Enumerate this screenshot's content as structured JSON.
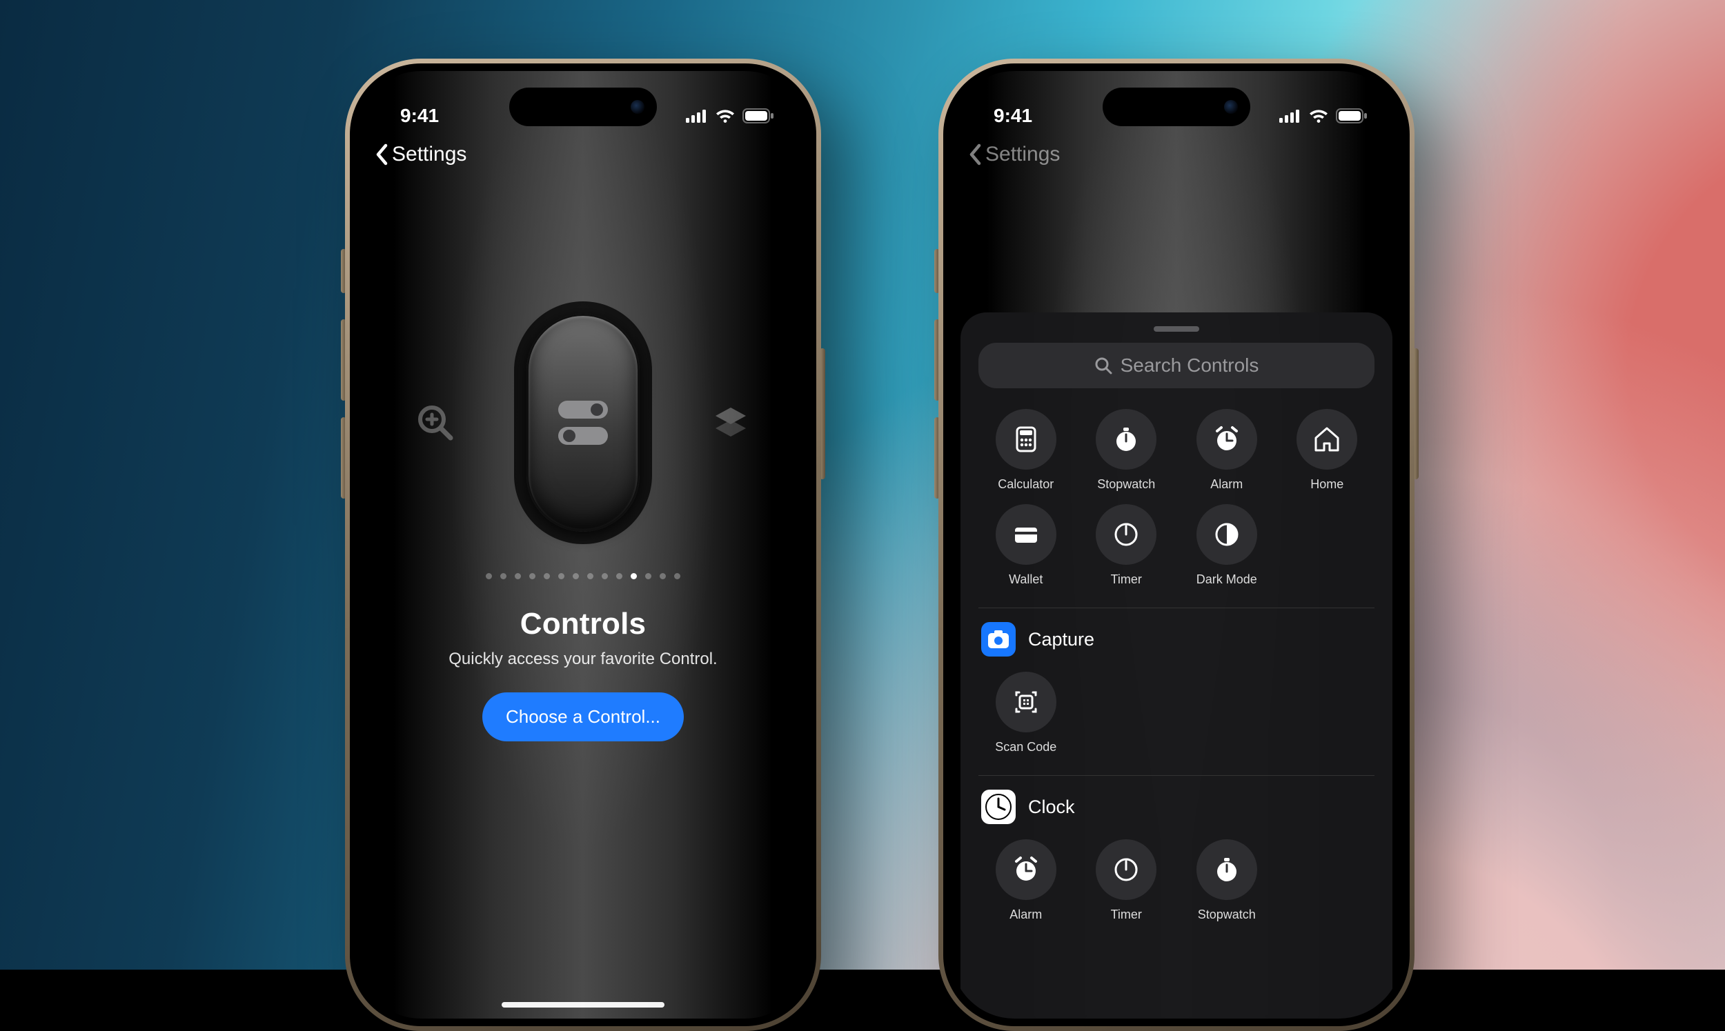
{
  "status": {
    "time": "9:41"
  },
  "nav": {
    "back": "Settings"
  },
  "left": {
    "title": "Controls",
    "subtitle": "Quickly access your favorite Control.",
    "button": "Choose a Control...",
    "page_dots": 14,
    "active_dot_index": 10
  },
  "right": {
    "search_placeholder": "Search Controls",
    "featured": [
      {
        "name": "Calculator",
        "icon": "calculator"
      },
      {
        "name": "Stopwatch",
        "icon": "stopwatch"
      },
      {
        "name": "Alarm",
        "icon": "alarm"
      },
      {
        "name": "Home",
        "icon": "home"
      },
      {
        "name": "Wallet",
        "icon": "wallet"
      },
      {
        "name": "Timer",
        "icon": "timer"
      },
      {
        "name": "Dark Mode",
        "icon": "darkmode"
      }
    ],
    "sections": [
      {
        "title": "Capture",
        "badge": "camera",
        "items": [
          {
            "name": "Scan Code",
            "icon": "scan"
          }
        ]
      },
      {
        "title": "Clock",
        "badge": "clock",
        "items": [
          {
            "name": "Alarm",
            "icon": "alarm"
          },
          {
            "name": "Timer",
            "icon": "timer"
          },
          {
            "name": "Stopwatch",
            "icon": "stopwatch"
          }
        ]
      }
    ]
  }
}
